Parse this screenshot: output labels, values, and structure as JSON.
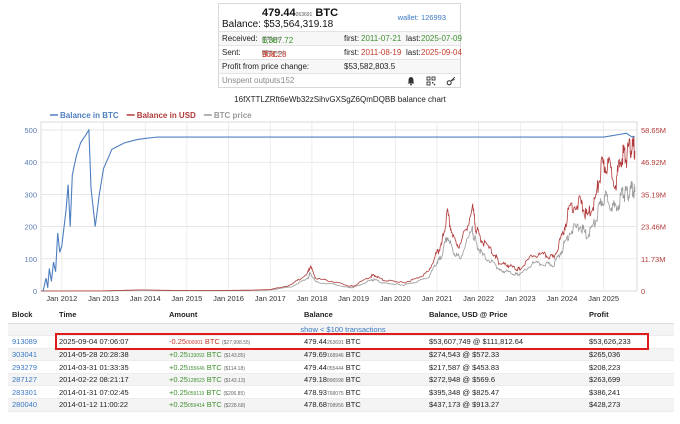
{
  "info": {
    "balance_btc": "479.44",
    "balance_btc_small": "263691",
    "balance_btc_unit": "BTC",
    "balance_usd": "Balance: $53,564,319.18",
    "wallet": "wallet: 126993",
    "received_label": "Received:",
    "received_value": "1,387.72",
    "received_unit": "BTC",
    "received_count": "(358 ins)",
    "received_first_label": "first:",
    "received_first": "2011-07-21",
    "received_last_label": "last:",
    "received_last": "2025-07-09",
    "sent_label": "Sent:",
    "sent_value": "908.28",
    "sent_small": "04",
    "sent_unit": "BTC",
    "sent_count": "(206 outs)",
    "sent_first_label": "first:",
    "sent_first": "2011-08-19",
    "sent_last_label": "last:",
    "sent_last": "2025-09-04",
    "profit_label": "Profit from price change:",
    "profit_value": "$53,582,803.5",
    "unspent_label": "Unspent outputs:",
    "unspent_value": "152",
    "icons": [
      "bell-icon",
      "qr-code-icon",
      "key-icon"
    ]
  },
  "chart_title": "16fXTTLZRft6eWb32zSihvGXSgZ6QmDQBB balance chart",
  "chart_data": {
    "type": "line",
    "legend": [
      "Balance in BTC",
      "Balance in USD",
      "BTC price"
    ],
    "legend_position": "top-left",
    "colors": {
      "balance_btc": "#4f7fc0",
      "balance_usd": "#b23a3a",
      "btc_price": "#999999"
    },
    "x_ticks": [
      "Jan 2012",
      "Jan 2013",
      "Jan 2014",
      "Jan 2015",
      "Jan 2016",
      "Jan 2017",
      "Jan 2018",
      "Jan 2019",
      "Jan 2020",
      "Jan 2021",
      "Jan 2022",
      "Jan 2023",
      "Jan 2024",
      "Jan 2025"
    ],
    "y_left_ticks": [
      "0",
      "100",
      "200",
      "300",
      "400",
      "500"
    ],
    "y_left_range": [
      0,
      500
    ],
    "y_right_ticks": [
      "0",
      "11.73M",
      "23.46M",
      "35.19M",
      "46.92M",
      "58.65M"
    ],
    "y_right_range": [
      0,
      58650000
    ],
    "grid": true,
    "series": [
      {
        "name": "Balance in BTC",
        "axis": "left",
        "x": [
          2011.55,
          2011.62,
          2011.66,
          2011.7,
          2011.75,
          2011.8,
          2011.85,
          2011.9,
          2011.95,
          2012.0,
          2012.1,
          2012.15,
          2012.2,
          2012.25,
          2012.3,
          2012.35,
          2012.4,
          2012.45,
          2012.55,
          2012.6,
          2012.65,
          2012.7,
          2012.8,
          2012.9,
          2013.0,
          2013.2,
          2013.5,
          2013.8,
          2014.0,
          2014.3,
          2015,
          2017,
          2019,
          2021,
          2023,
          2025.0,
          2025.55,
          2025.67,
          2025.75
        ],
        "y": [
          0,
          40,
          10,
          70,
          30,
          90,
          60,
          180,
          120,
          140,
          250,
          330,
          200,
          360,
          390,
          420,
          440,
          460,
          480,
          490,
          500,
          320,
          200,
          300,
          380,
          440,
          460,
          470,
          474,
          478,
          478,
          478,
          478,
          478,
          478,
          478,
          490,
          479,
          479
        ]
      },
      {
        "name": "Balance in USD",
        "axis": "right",
        "x": [
          2011.5,
          2013.0,
          2013.9,
          2014.5,
          2015.5,
          2016.5,
          2017.0,
          2017.5,
          2017.9,
          2017.96,
          2018.1,
          2018.5,
          2018.9,
          2019.0,
          2019.4,
          2019.5,
          2019.7,
          2020.0,
          2020.2,
          2020.5,
          2020.8,
          2021.0,
          2021.1,
          2021.25,
          2021.4,
          2021.55,
          2021.85,
          2021.95,
          2022.1,
          2022.4,
          2022.5,
          2022.7,
          2022.9,
          2023.0,
          2023.3,
          2023.6,
          2023.8,
          2024.0,
          2024.2,
          2024.45,
          2024.6,
          2024.8,
          2024.95,
          2025.1,
          2025.3,
          2025.45,
          2025.55,
          2025.67,
          2025.75
        ],
        "y": [
          0,
          0.05,
          0.4,
          0.25,
          0.15,
          0.3,
          0.5,
          2.2,
          6.5,
          9.0,
          4.5,
          3.5,
          1.8,
          1.8,
          5.2,
          5.8,
          4.0,
          3.5,
          3.0,
          4.5,
          7.0,
          14,
          16,
          28,
          19,
          16,
          30,
          22,
          18,
          13,
          10,
          9.5,
          8,
          8,
          13,
          13,
          12,
          20,
          31,
          32,
          27,
          33,
          45,
          46,
          40,
          50,
          49,
          53,
          51
        ]
      },
      {
        "name": "BTC price",
        "axis": "right",
        "x": [
          2011.5,
          2013.0,
          2013.9,
          2014.5,
          2015.5,
          2016.5,
          2017.0,
          2017.5,
          2017.9,
          2017.96,
          2018.1,
          2018.5,
          2018.9,
          2019.0,
          2019.4,
          2019.5,
          2019.7,
          2020.0,
          2020.2,
          2020.5,
          2020.8,
          2021.0,
          2021.1,
          2021.25,
          2021.4,
          2021.55,
          2021.85,
          2021.95,
          2022.1,
          2022.4,
          2022.5,
          2022.7,
          2022.9,
          2023.0,
          2023.3,
          2023.6,
          2023.8,
          2024.0,
          2024.2,
          2024.45,
          2024.6,
          2024.8,
          2024.95,
          2025.1,
          2025.3,
          2025.45,
          2025.55,
          2025.67,
          2025.75
        ],
        "y": [
          0,
          0.01,
          0.3,
          0.2,
          0.1,
          0.2,
          0.4,
          1.5,
          4.5,
          6.5,
          3.2,
          2.5,
          1.2,
          1.3,
          3.8,
          4.2,
          2.9,
          2.5,
          2.2,
          3.3,
          5.0,
          10.5,
          12,
          20,
          14,
          12,
          22,
          17,
          13,
          9.5,
          7.5,
          7,
          6,
          6,
          10,
          9.8,
          9.5,
          15,
          22,
          23.5,
          20,
          25,
          33,
          34,
          29,
          36,
          35,
          37,
          36
        ]
      }
    ]
  },
  "table": {
    "headers": [
      "Block",
      "Time",
      "Amount",
      "Balance",
      "Balance, USD @ Price",
      "Profit"
    ],
    "show_more": "show < $100 transactions",
    "rows": [
      {
        "block": "913089",
        "time": "2025-09-04 07:06:07",
        "amount": "-0.25",
        "amount_small": "000001",
        "amount_unit": "BTC",
        "amount_usd": "($27,998.55)",
        "balance": "479.44",
        "balance_small": "263691",
        "balance_unit": "BTC",
        "usd_price": "$53,607,749 @ $111,812.64",
        "profit": "$53,626,233",
        "sign": "neg"
      },
      {
        "block": "303041",
        "time": "2014-05-28 20:28:38",
        "amount": "+0.25",
        "amount_small": "133092",
        "amount_unit": "BTC",
        "amount_usd": "($143.85)",
        "balance": "479.69",
        "balance_small": "168946",
        "balance_unit": "BTC",
        "usd_price": "$274,543 @ $572.33",
        "profit": "$265,036",
        "sign": "pos"
      },
      {
        "block": "293279",
        "time": "2014-03-31 01:33:35",
        "amount": "+0.25",
        "amount_small": "155646",
        "amount_unit": "BTC",
        "amount_usd": "($114.18)",
        "balance": "479.44",
        "balance_small": "055444",
        "balance_unit": "BTC",
        "usd_price": "$217,587 @ $453.83",
        "profit": "$208,223",
        "sign": "pos"
      },
      {
        "block": "287127",
        "time": "2014-02-22 08:21:17",
        "amount": "+0.25",
        "amount_small": "128523",
        "amount_unit": "BTC",
        "amount_usd": "($143.13)",
        "balance": "479.18",
        "balance_small": "896598",
        "balance_unit": "BTC",
        "usd_price": "$272,948 @ $569.6",
        "profit": "$263,699",
        "sign": "pos"
      },
      {
        "block": "283301",
        "time": "2014-01-31 07:02:45",
        "amount": "+0.25",
        "amount_small": "059119",
        "amount_unit": "BTC",
        "amount_usd": "($206.85)",
        "balance": "478.93",
        "balance_small": "768075",
        "balance_unit": "BTC",
        "usd_price": "$395,348 @ $825.47",
        "profit": "$386,241",
        "sign": "pos"
      },
      {
        "block": "280040",
        "time": "2014-01-12 11:00:22",
        "amount": "+0.25",
        "amount_small": "059414",
        "amount_unit": "BTC",
        "amount_usd": "($228.68)",
        "balance": "478.68",
        "balance_small": "708956",
        "balance_unit": "BTC",
        "usd_price": "$437,173 @ $913.27",
        "profit": "$428,273",
        "sign": "pos"
      }
    ]
  }
}
